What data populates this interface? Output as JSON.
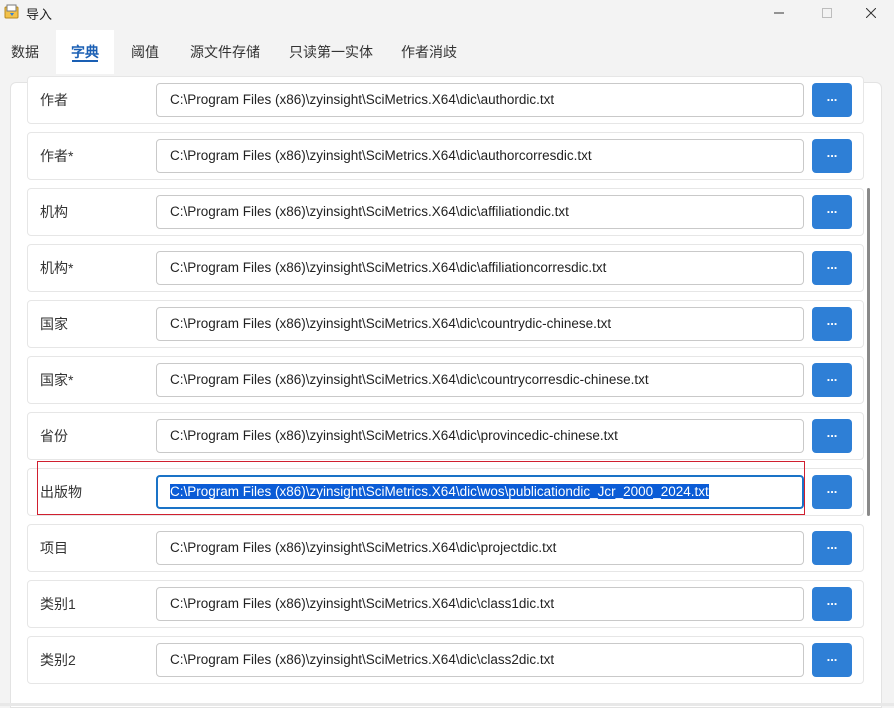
{
  "window": {
    "title": "导入"
  },
  "tabs": [
    {
      "label": "数据"
    },
    {
      "label": "字典"
    },
    {
      "label": "阈值"
    },
    {
      "label": "源文件存储"
    },
    {
      "label": "只读第一实体"
    },
    {
      "label": "作者消歧"
    }
  ],
  "active_tab": "字典",
  "rows": [
    {
      "label": "作者",
      "value": "C:\\Program Files (x86)\\zyinsight\\SciMetrics.X64\\dic\\authordic.txt",
      "button": "..."
    },
    {
      "label": "作者*",
      "value": "C:\\Program Files (x86)\\zyinsight\\SciMetrics.X64\\dic\\authorcorresdic.txt",
      "button": "..."
    },
    {
      "label": "机构",
      "value": "C:\\Program Files (x86)\\zyinsight\\SciMetrics.X64\\dic\\affiliationdic.txt",
      "button": "..."
    },
    {
      "label": "机构*",
      "value": "C:\\Program Files (x86)\\zyinsight\\SciMetrics.X64\\dic\\affiliationcorresdic.txt",
      "button": "..."
    },
    {
      "label": "国家",
      "value": "C:\\Program Files (x86)\\zyinsight\\SciMetrics.X64\\dic\\countrydic-chinese.txt",
      "button": "..."
    },
    {
      "label": "国家*",
      "value": "C:\\Program Files (x86)\\zyinsight\\SciMetrics.X64\\dic\\countrycorresdic-chinese.txt",
      "button": "..."
    },
    {
      "label": "省份",
      "value": "C:\\Program Files (x86)\\zyinsight\\SciMetrics.X64\\dic\\provincedic-chinese.txt",
      "button": "..."
    },
    {
      "label": "出版物",
      "value": "C:\\Program Files (x86)\\zyinsight\\SciMetrics.X64\\dic\\wos\\publicationdic_Jcr_2000_2024.txt",
      "button": "..."
    },
    {
      "label": "项目",
      "value": "C:\\Program Files (x86)\\zyinsight\\SciMetrics.X64\\dic\\projectdic.txt",
      "button": "..."
    },
    {
      "label": "类别1",
      "value": "C:\\Program Files (x86)\\zyinsight\\SciMetrics.X64\\dic\\class1dic.txt",
      "button": "..."
    },
    {
      "label": "类别2",
      "value": "C:\\Program Files (x86)\\zyinsight\\SciMetrics.X64\\dic\\class2dic.txt",
      "button": "..."
    }
  ],
  "focused_row": "出版物",
  "colors": {
    "accent": "#2e7fd6",
    "active_tab": "#1a5fb4",
    "selection": "#0b5cd6",
    "highlight": "#d01f2f"
  },
  "icons": {
    "app": "import-app-icon",
    "minimize": "minimize-icon",
    "maximize": "maximize-icon",
    "close": "close-icon"
  }
}
